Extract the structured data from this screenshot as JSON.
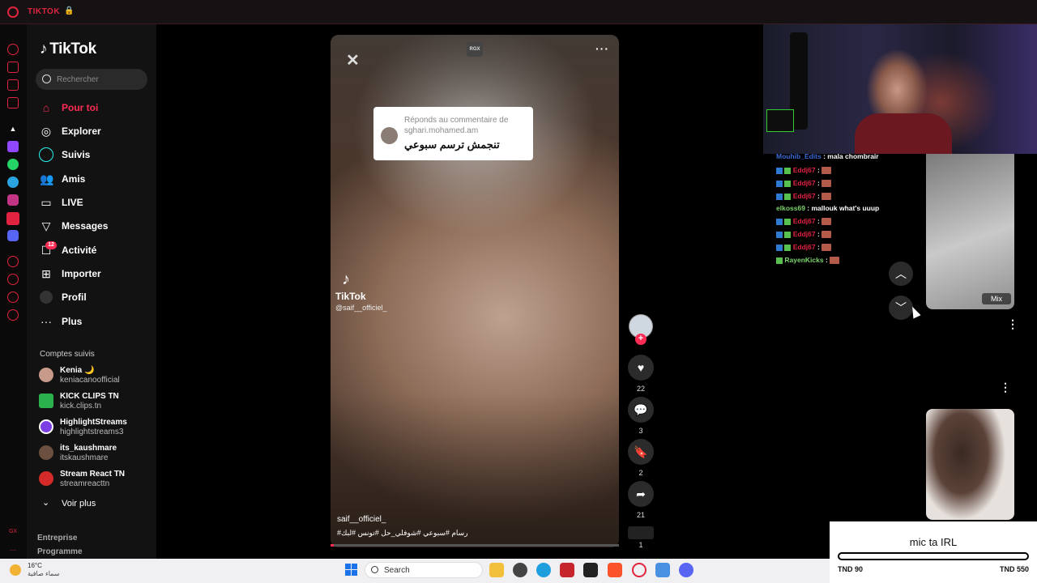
{
  "window": {
    "title": "TIKTOK"
  },
  "tiktok": {
    "logo": "TikTok",
    "search_placeholder": "Rechercher",
    "nav": [
      {
        "label": "Pour toi",
        "icon": "home-icon"
      },
      {
        "label": "Explorer",
        "icon": "compass-icon"
      },
      {
        "label": "Suivis",
        "icon": "following-icon"
      },
      {
        "label": "Amis",
        "icon": "friends-icon"
      },
      {
        "label": "LIVE",
        "icon": "live-icon"
      },
      {
        "label": "Messages",
        "icon": "send-icon"
      },
      {
        "label": "Activité",
        "icon": "inbox-icon"
      },
      {
        "label": "Importer",
        "icon": "upload-icon"
      },
      {
        "label": "Profil",
        "icon": "profile-icon"
      },
      {
        "label": "Plus",
        "icon": "more-icon"
      }
    ],
    "activity_badge": "12",
    "followed_title": "Comptes suivis",
    "accounts": [
      {
        "name": "Kenia 🌙",
        "handle": "keniacanoofficial"
      },
      {
        "name": "KICK CLIPS TN",
        "handle": "kick.clips.tn"
      },
      {
        "name": "HighlightStreams",
        "handle": "highlightstreams3"
      },
      {
        "name": "its_kaushmare",
        "handle": "itskaushmare"
      },
      {
        "name": "Stream React TN",
        "handle": "streamreacttn"
      }
    ],
    "see_more": "Voir plus",
    "footer": [
      "Entreprise",
      "Programme"
    ]
  },
  "video": {
    "rgx_chip": "RGX",
    "reply_line1": "Réponds au commentaire de",
    "reply_line2": "sghari.mohamed.am",
    "reply_text": "تنجمش ترسم سبوعي",
    "watermark_label": "TikTok",
    "watermark_handle": "@saif__officiel_",
    "author": "saif__officiel_",
    "tags": "#رسام #سبوعي #شوفلي_حل #تونس #لبك",
    "likes": "22",
    "comments": "3",
    "saves": "2",
    "shares": "21",
    "extra": "1",
    "progress": 0.01
  },
  "chat": {
    "lines": [
      {
        "user": "Mouhib_Edits",
        "msg": "mala chombrair",
        "color": "#3a6bd6"
      },
      {
        "user": "Eddj67",
        "msg": "",
        "color": "#e0243f"
      },
      {
        "user": "Eddj67",
        "msg": "",
        "color": "#e0243f"
      },
      {
        "user": "Eddj67",
        "msg": "",
        "color": "#e0243f"
      },
      {
        "user": "elkoss69",
        "msg": "mallouk what's uuup",
        "color": "#7bd36b"
      },
      {
        "user": "Eddj67",
        "msg": "",
        "color": "#e0243f"
      },
      {
        "user": "Eddj67",
        "msg": "",
        "color": "#e0243f"
      },
      {
        "user": "Eddj67",
        "msg": "",
        "color": "#e0243f"
      },
      {
        "user": "RayenKicks",
        "msg": "",
        "color": "#7bd36b"
      }
    ]
  },
  "side": {
    "mix_label": "Mix"
  },
  "goal": {
    "title": "mic ta IRL",
    "min": "TND 90",
    "max": "TND 550"
  },
  "taskbar": {
    "temp": "16°C",
    "weather": "سماء صافية",
    "search": "Search"
  },
  "colors": {
    "brand": "#fe2c55",
    "opera": "#e0243f"
  }
}
